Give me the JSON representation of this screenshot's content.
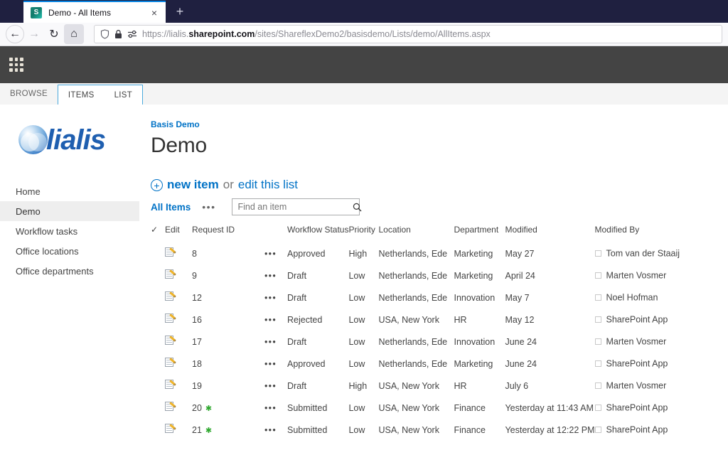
{
  "browser": {
    "tab": {
      "title": "Demo - All Items",
      "favicon": "sharepoint-icon",
      "favicon_letter": "S",
      "close_label": "×"
    },
    "new_tab_label": "+",
    "nav": {
      "back": "←",
      "forward": "→",
      "reload": "↻",
      "home": "⌂"
    },
    "url": {
      "scheme": "https://",
      "host_prefix": "lialis.",
      "host_bold": "sharepoint.com",
      "path": "/sites/ShareflexDemo2/basisdemo/Lists/demo/AllItems.aspx",
      "full": "https://lialis.sharepoint.com/sites/ShareflexDemo2/basisdemo/Lists/demo/AllItems.aspx",
      "shield_icon": "shield-icon",
      "lock_icon": "lock-icon",
      "permissions_icon": "permissions-icon"
    }
  },
  "suitebar": {
    "app_launcher_label": "app-launcher"
  },
  "ribbon": {
    "browse": "BROWSE",
    "items": "ITEMS",
    "list": "LIST"
  },
  "sidebar": {
    "logo_text": "lialis",
    "items": [
      {
        "label": "Home",
        "selected": false
      },
      {
        "label": "Demo",
        "selected": true
      },
      {
        "label": "Workflow tasks",
        "selected": false
      },
      {
        "label": "Office locations",
        "selected": false
      },
      {
        "label": "Office departments",
        "selected": false
      }
    ]
  },
  "main": {
    "breadcrumb": "Basis Demo",
    "title": "Demo",
    "new_item": "new item",
    "or": "or",
    "edit_this_list": "edit this list",
    "view_name": "All Items",
    "view_menu": "•••",
    "search_placeholder": "Find an item",
    "search_value": "",
    "search_icon": "search-icon"
  },
  "table": {
    "headers": {
      "check": "✓",
      "edit": "Edit",
      "request_id": "Request ID",
      "workflow_status": "Workflow Status",
      "priority": "Priority",
      "location": "Location",
      "department": "Department",
      "modified": "Modified",
      "modified_by": "Modified By"
    },
    "row_menu": "•••",
    "new_marker": "✱",
    "rows": [
      {
        "id": "8",
        "is_new": false,
        "status": "Approved",
        "priority": "High",
        "location": "Netherlands, Ede",
        "department": "Marketing",
        "modified": "May 27",
        "modified_by": "Tom van der Staaij"
      },
      {
        "id": "9",
        "is_new": false,
        "status": "Draft",
        "priority": "Low",
        "location": "Netherlands, Ede",
        "department": "Marketing",
        "modified": "April 24",
        "modified_by": "Marten Vosmer"
      },
      {
        "id": "12",
        "is_new": false,
        "status": "Draft",
        "priority": "Low",
        "location": "Netherlands, Ede",
        "department": "Innovation",
        "modified": "May 7",
        "modified_by": "Noel Hofman"
      },
      {
        "id": "16",
        "is_new": false,
        "status": "Rejected",
        "priority": "Low",
        "location": "USA, New York",
        "department": "HR",
        "modified": "May 12",
        "modified_by": "SharePoint App"
      },
      {
        "id": "17",
        "is_new": false,
        "status": "Draft",
        "priority": "Low",
        "location": "Netherlands, Ede",
        "department": "Innovation",
        "modified": "June 24",
        "modified_by": "Marten Vosmer"
      },
      {
        "id": "18",
        "is_new": false,
        "status": "Approved",
        "priority": "Low",
        "location": "Netherlands, Ede",
        "department": "Marketing",
        "modified": "June 24",
        "modified_by": "SharePoint App"
      },
      {
        "id": "19",
        "is_new": false,
        "status": "Draft",
        "priority": "High",
        "location": "USA, New York",
        "department": "HR",
        "modified": "July 6",
        "modified_by": "Marten Vosmer"
      },
      {
        "id": "20",
        "is_new": true,
        "status": "Submitted",
        "priority": "Low",
        "location": "USA, New York",
        "department": "Finance",
        "modified": "Yesterday at 11:43 AM",
        "modified_by": "SharePoint App"
      },
      {
        "id": "21",
        "is_new": true,
        "status": "Submitted",
        "priority": "Low",
        "location": "USA, New York",
        "department": "Finance",
        "modified": "Yesterday at 12:22 PM",
        "modified_by": "SharePoint App"
      }
    ]
  },
  "colors": {
    "accent_blue": "#0072c6",
    "titlebar": "#1f2040",
    "suitebar": "#444444",
    "ribbon_bg": "#f4f4f4",
    "ribbon_active_border": "#4aa9dd",
    "logo_blue": "#1f5fb0",
    "new_marker_green": "#2ea82e",
    "sidebar_selected": "#eeeeee"
  }
}
